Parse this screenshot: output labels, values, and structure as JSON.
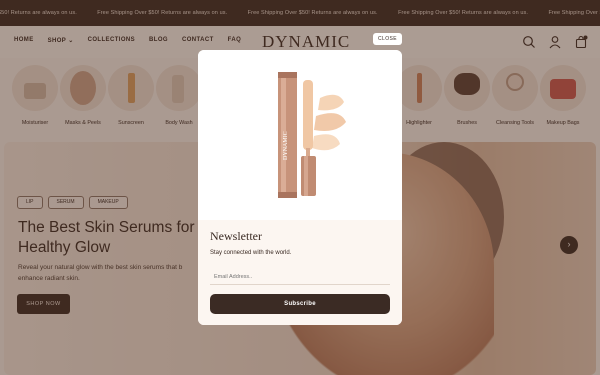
{
  "announcement": {
    "messages": [
      "$50! Returns are always on us.",
      "Free Shipping Over $50! Returns are always on us.",
      "Free Shipping Over $50! Returns are always on us.",
      "Free Shipping Over $50! Returns are always on us.",
      "Free Shipping Over $50! Returns are always on us."
    ]
  },
  "header": {
    "nav": [
      "HOME",
      "SHOP",
      "COLLECTIONS",
      "BLOG",
      "CONTACT",
      "FAQ"
    ],
    "shop_chevron": "⌄",
    "logo": "DYNAMIC",
    "icons": [
      "search-icon",
      "account-icon",
      "cart-icon"
    ]
  },
  "categories": [
    {
      "label": "Moisturiser"
    },
    {
      "label": "Masks & Peels"
    },
    {
      "label": "Sunscreen"
    },
    {
      "label": "Body Wash"
    },
    {
      "label": "Highlighter"
    },
    {
      "label": "Brushes"
    },
    {
      "label": "Cleansing Tools"
    },
    {
      "label": "Makeup Bags"
    }
  ],
  "hero": {
    "tags": [
      "LIP",
      "SERUM",
      "MAKEUP"
    ],
    "title": "The Best Skin Serums for Healthy Glow",
    "text": "Reveal your natural glow with the best skin serums that b enhance radiant skin.",
    "button": "SHOP NOW",
    "next_arrow": "›"
  },
  "modal": {
    "close_label": "CLOSE",
    "title": "Newsletter",
    "subtitle": "Stay connected with the world.",
    "email_placeholder": "Email Address..",
    "subscribe_label": "Subscribe",
    "product_brand": "DYNAMIC"
  },
  "colors": {
    "brand_dark": "#3b2b24",
    "page_bg": "#f3ece6",
    "overlay": "rgba(68,40,28,0.42)"
  }
}
